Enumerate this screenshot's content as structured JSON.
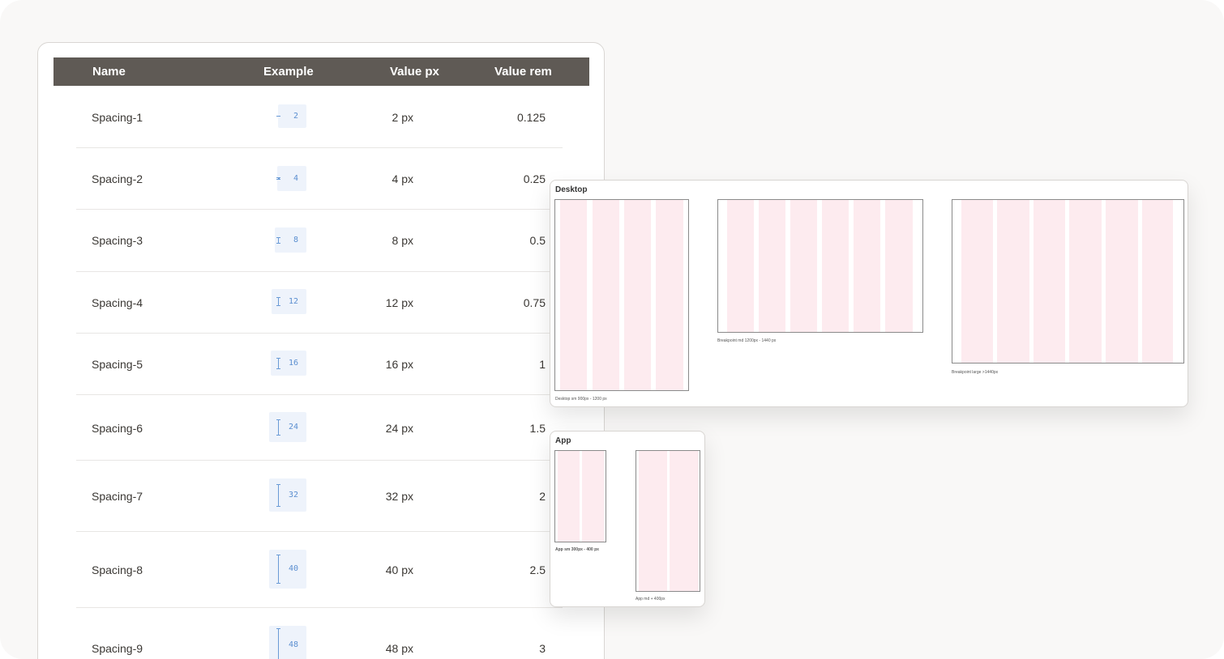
{
  "table": {
    "headers": {
      "name": "Name",
      "example": "Example",
      "px": "Value px",
      "rem": "Value rem"
    },
    "rows": [
      {
        "name": "Spacing-1",
        "example": "2",
        "px": "2 px",
        "rem": "0.125"
      },
      {
        "name": "Spacing-2",
        "example": "4",
        "px": "4 px",
        "rem": "0.25"
      },
      {
        "name": "Spacing-3",
        "example": "8",
        "px": "8 px",
        "rem": "0.5"
      },
      {
        "name": "Spacing-4",
        "example": "12",
        "px": "12 px",
        "rem": "0.75"
      },
      {
        "name": "Spacing-5",
        "example": "16",
        "px": "16 px",
        "rem": "1"
      },
      {
        "name": "Spacing-6",
        "example": "24",
        "px": "24 px",
        "rem": "1.5"
      },
      {
        "name": "Spacing-7",
        "example": "32",
        "px": "32 px",
        "rem": "2"
      },
      {
        "name": "Spacing-8",
        "example": "40",
        "px": "40 px",
        "rem": "2.5"
      },
      {
        "name": "Spacing-9",
        "example": "48",
        "px": "48 px",
        "rem": "3"
      }
    ]
  },
  "desktop": {
    "title": "Desktop",
    "sm_caption": "Desktop sm 900px - 1200 px",
    "md_caption": "Breakpoint md 1200px - 1440 px",
    "lg_caption": "Breakpoint large >1440px"
  },
  "app": {
    "title": "App",
    "sm_caption": "App sm  300px - 400 px",
    "md_caption": "App md  +  400px"
  },
  "colors": {
    "header_bg": "#5f5a55",
    "column_fill": "#fdebef",
    "example_bg": "#eef3fb",
    "example_accent": "#5b8fd0"
  }
}
